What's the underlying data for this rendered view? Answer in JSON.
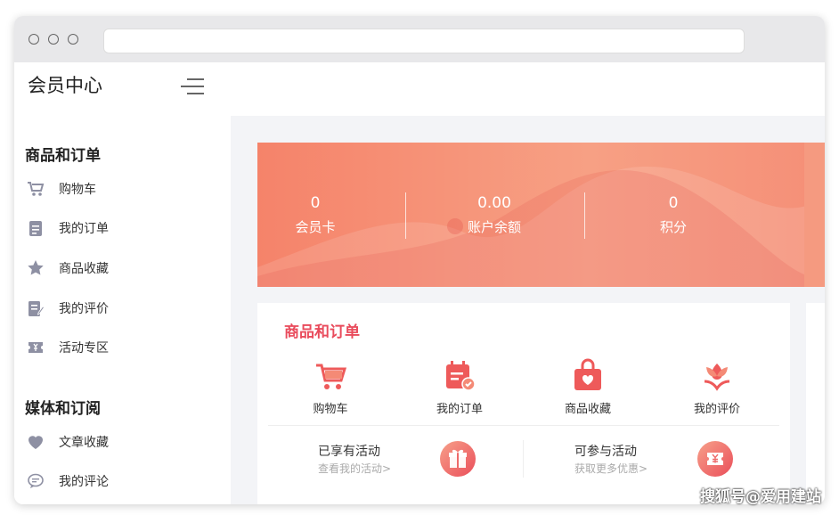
{
  "app": {
    "title": "会员中心"
  },
  "sidebar": {
    "sections": [
      {
        "title": "商品和订单",
        "items": [
          "购物车",
          "我的订单",
          "商品收藏",
          "我的评价",
          "活动专区"
        ]
      },
      {
        "title": "媒体和订阅",
        "items": [
          "文章收藏",
          "我的评论"
        ]
      }
    ]
  },
  "banner": {
    "stats": [
      {
        "value": "0",
        "label": "会员卡"
      },
      {
        "value": "0.00",
        "label": "账户余额"
      },
      {
        "value": "0",
        "label": "积分"
      }
    ]
  },
  "orders_card": {
    "title": "商品和订单",
    "icons": [
      "购物车",
      "我的订单",
      "商品收藏",
      "我的评价"
    ],
    "activities": [
      {
        "title": "已享有活动",
        "sub": "查看我的活动>"
      },
      {
        "title": "可参与活动",
        "sub": "获取更多优惠>"
      }
    ]
  },
  "watermark": "搜狐号@爱用建站",
  "colors": {
    "accent": "#e94b5c",
    "banner": "#f5836a",
    "sidebar_icon": "#8e90a3"
  }
}
